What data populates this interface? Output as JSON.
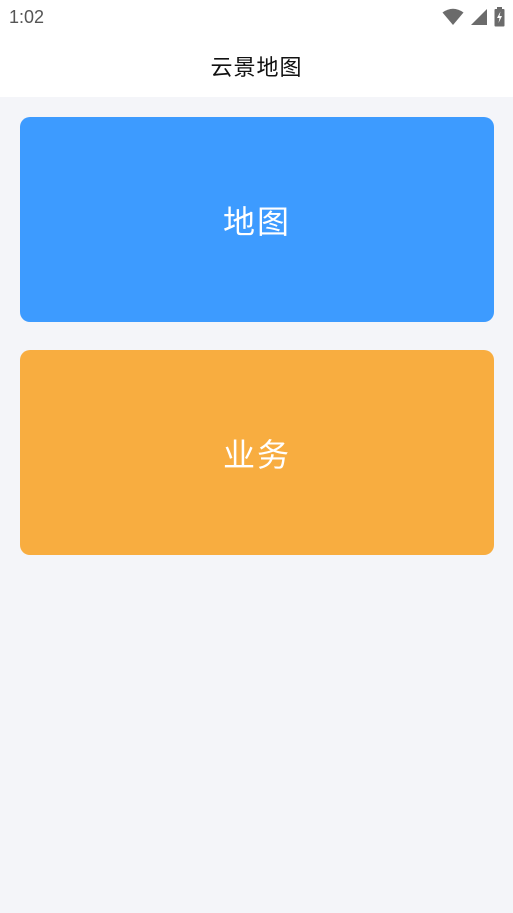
{
  "status_bar": {
    "time": "1:02",
    "icons": [
      "wifi-icon",
      "signal-icon",
      "battery-charging-icon"
    ]
  },
  "header": {
    "title": "云景地图"
  },
  "cards": [
    {
      "label": "地图",
      "color": "#3d9bff"
    },
    {
      "label": "业务",
      "color": "#f8ad40"
    }
  ],
  "colors": {
    "background": "#f4f5f9",
    "header_background": "#ffffff"
  }
}
